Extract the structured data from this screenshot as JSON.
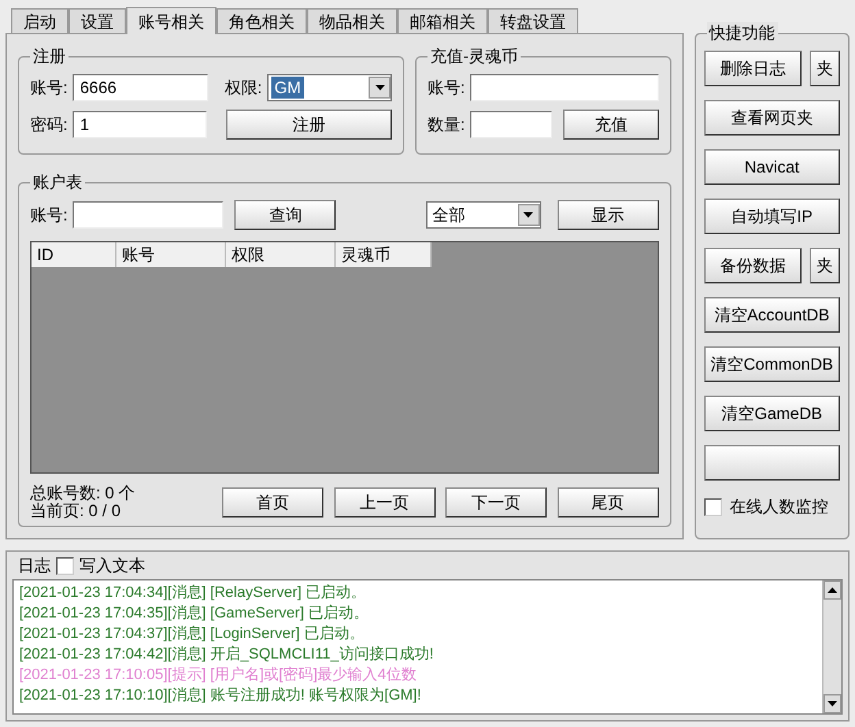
{
  "tabs": [
    {
      "label": "启动",
      "selected": false
    },
    {
      "label": "设置",
      "selected": false
    },
    {
      "label": "账号相关",
      "selected": true
    },
    {
      "label": "角色相关",
      "selected": false
    },
    {
      "label": "物品相关",
      "selected": false
    },
    {
      "label": "邮箱相关",
      "selected": false
    },
    {
      "label": "转盘设置",
      "selected": false
    }
  ],
  "register": {
    "title": "注册",
    "account_label": "账号:",
    "account_value": "6666",
    "password_label": "密码:",
    "password_value": "1",
    "role_label": "权限:",
    "role_value": "GM",
    "button": "注册"
  },
  "recharge": {
    "title": "充值-灵魂币",
    "account_label": "账号:",
    "amount_label": "数量:",
    "button": "充值"
  },
  "accounts": {
    "title": "账户表",
    "account_label": "账号:",
    "query_button": "查询",
    "filter_value": "全部",
    "show_button": "显示",
    "columns": [
      "ID",
      "账号",
      "权限",
      "灵魂币"
    ],
    "total": "总账号数: 0 个",
    "page": "当前页: 0 / 0",
    "nav_buttons": [
      "首页",
      "上一页",
      "下一页",
      "尾页"
    ]
  },
  "shortcuts": {
    "title": "快捷功能",
    "buttons": [
      {
        "kind": "labeled",
        "label": "删除日志",
        "side": "夹"
      },
      {
        "kind": "labeled",
        "label": "查看网页夹"
      },
      {
        "kind": "labeled",
        "label": "Navicat"
      },
      {
        "kind": "labeled",
        "label": "自动填写IP"
      },
      {
        "kind": "labeled",
        "label": "备份数据",
        "side": "夹"
      },
      {
        "kind": "labeled",
        "label": "清空AccountDB"
      },
      {
        "kind": "labeled",
        "label": "清空CommonDB"
      },
      {
        "kind": "labeled",
        "label": "清空GameDB"
      },
      {
        "kind": "blank"
      }
    ],
    "monitor": {
      "label": "在线人数监控",
      "checked": false
    }
  },
  "log": {
    "title": "日志",
    "write_text": {
      "label": "写入文本",
      "checked": false
    },
    "lines": [
      {
        "kind": "info",
        "text": "[2021-01-23 17:04:34][消息] [RelayServer] 已启动。"
      },
      {
        "kind": "info",
        "text": "[2021-01-23 17:04:35][消息] [GameServer] 已启动。"
      },
      {
        "kind": "info",
        "text": "[2021-01-23 17:04:37][消息] [LoginServer] 已启动。"
      },
      {
        "kind": "info",
        "text": "[2021-01-23 17:04:42][消息] 开启_SQLMCLI11_访问接口成功!"
      },
      {
        "kind": "hint",
        "text": "[2021-01-23 17:10:05][提示] [用户名]或[密码]最少输入4位数"
      },
      {
        "kind": "info",
        "text": "[2021-01-23 17:10:10][消息] 账号注册成功! 账号权限为[GM]!"
      }
    ]
  }
}
